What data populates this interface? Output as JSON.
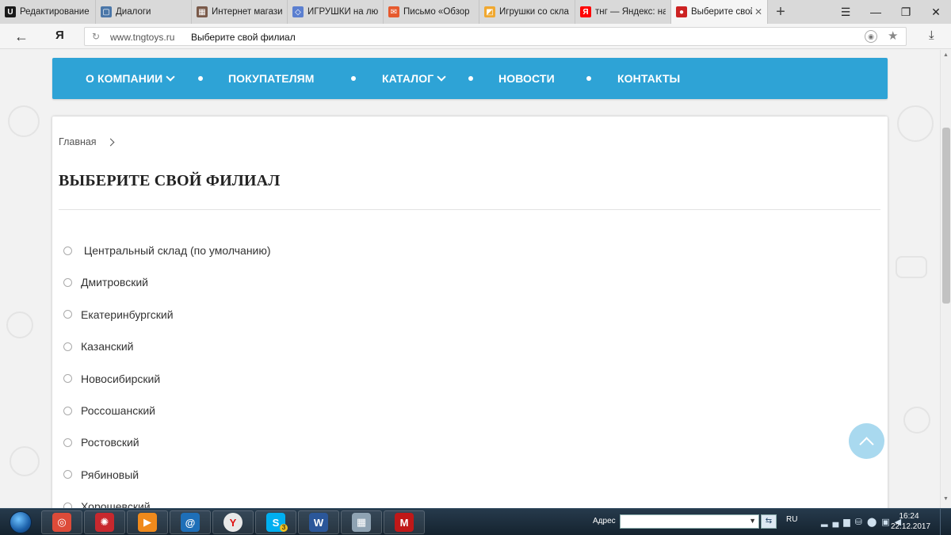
{
  "browser": {
    "tabs": [
      {
        "label": "Редактирование",
        "favicon_color": "#1a1a1a",
        "favicon_glyph": "U",
        "active": false
      },
      {
        "label": "Диалоги",
        "favicon_color": "#4a76a8",
        "favicon_glyph": "▢",
        "active": false
      },
      {
        "label": "Интернет магази",
        "favicon_color": "#7a5a4a",
        "favicon_glyph": "▦",
        "active": false
      },
      {
        "label": "ИГРУШКИ на лю",
        "favicon_color": "#5b7fd0",
        "favicon_glyph": "◇",
        "active": false
      },
      {
        "label": "Письмо «Обзор",
        "favicon_color": "#e65a2e",
        "favicon_glyph": "✉",
        "active": false
      },
      {
        "label": "Игрушки со скла",
        "favicon_color": "#f0a830",
        "favicon_glyph": "◩",
        "active": false
      },
      {
        "label": "тнг — Яндекс: на",
        "favicon_color": "#ff0000",
        "favicon_glyph": "Я",
        "active": false
      },
      {
        "label": "Выберите свой",
        "favicon_color": "#cc2222",
        "favicon_glyph": "●",
        "active": true
      }
    ],
    "new_tab_glyph": "+",
    "address": {
      "yandex_logo": "Я",
      "domain": "www.tngtoys.ru",
      "page_title": "Выберите свой филиал"
    }
  },
  "site": {
    "accent_color": "#2ea3d6",
    "nav": [
      {
        "label": "О КОМПАНИИ",
        "has_dropdown": true
      },
      {
        "label": "ПОКУПАТЕЛЯМ",
        "has_dropdown": false
      },
      {
        "label": "КАТАЛОГ",
        "has_dropdown": true
      },
      {
        "label": "НОВОСТИ",
        "has_dropdown": false
      },
      {
        "label": "КОНТАКТЫ",
        "has_dropdown": false
      }
    ],
    "breadcrumb": "Главная",
    "heading": "ВЫБЕРИТЕ СВОЙ ФИЛИАЛ",
    "branches": [
      " Центральный склад (по умолчанию)",
      "Дмитровский",
      "Екатеринбургский",
      "Казанский",
      "Новосибирский",
      "Россошанский",
      "Ростовский",
      "Рябиновый",
      "Хорошевский"
    ]
  },
  "taskbar": {
    "apps": [
      {
        "name": "chrome",
        "color": "#dd4b39"
      },
      {
        "name": "app-red",
        "color": "#c8282e"
      },
      {
        "name": "media-player",
        "color": "#f08a1c"
      },
      {
        "name": "mail",
        "color": "#1e6fb8"
      },
      {
        "name": "yandex-browser",
        "color": "#e8e8e8"
      },
      {
        "name": "skype",
        "color": "#00aff0"
      },
      {
        "name": "word",
        "color": "#2b579a"
      },
      {
        "name": "calculator",
        "color": "#8fa3b3"
      },
      {
        "name": "mcafee",
        "color": "#c01818"
      }
    ],
    "skype_badge": "3",
    "address_label": "Адрес",
    "language": "RU",
    "time": "16:24",
    "date": "22.12.2017"
  }
}
